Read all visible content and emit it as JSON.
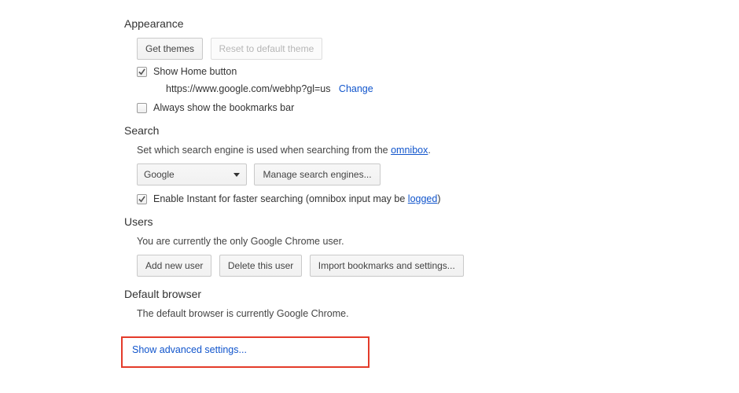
{
  "appearance": {
    "title": "Appearance",
    "get_themes": "Get themes",
    "reset_theme": "Reset to default theme",
    "show_home": "Show Home button",
    "home_url": "https://www.google.com/webhp?gl=us",
    "change": "Change",
    "always_show_bookmarks": "Always show the bookmarks bar"
  },
  "search": {
    "title": "Search",
    "description_prefix": "Set which search engine is used when searching from the ",
    "omnibox_link": "omnibox",
    "description_suffix": ".",
    "selected_engine": "Google",
    "manage_engines": "Manage search engines...",
    "enable_instant_prefix": "Enable Instant for faster searching (omnibox input may be ",
    "logged_link": "logged",
    "enable_instant_suffix": ")"
  },
  "users": {
    "title": "Users",
    "status": "You are currently the only Google Chrome user.",
    "add_user": "Add new user",
    "delete_user": "Delete this user",
    "import": "Import bookmarks and settings..."
  },
  "default_browser": {
    "title": "Default browser",
    "status": "The default browser is currently Google Chrome."
  },
  "advanced": {
    "link": "Show advanced settings..."
  }
}
